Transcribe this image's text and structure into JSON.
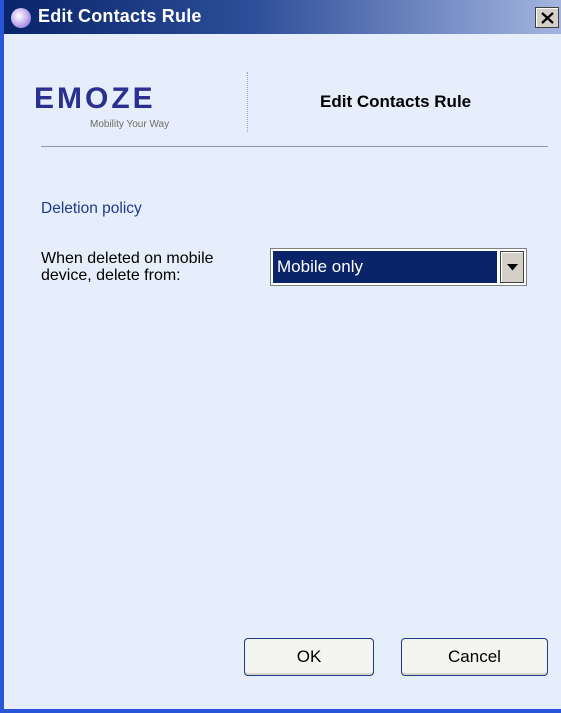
{
  "window": {
    "title": "Edit Contacts Rule"
  },
  "header": {
    "logo_word": "EMOZE",
    "logo_tagline": "Mobility Your Way",
    "title": "Edit Contacts Rule"
  },
  "form": {
    "section_label": "Deletion policy",
    "field_label": "When deleted on mobile device, delete from:",
    "deletion_select": {
      "selected": "Mobile only"
    }
  },
  "buttons": {
    "ok": "OK",
    "cancel": "Cancel"
  },
  "colors": {
    "title_bar": "#0a246a",
    "background": "#e6eefb",
    "selection": "#0a246a"
  },
  "icons": {
    "app": "app-icon",
    "close": "close-icon",
    "dropdown": "chevron-down-icon"
  }
}
